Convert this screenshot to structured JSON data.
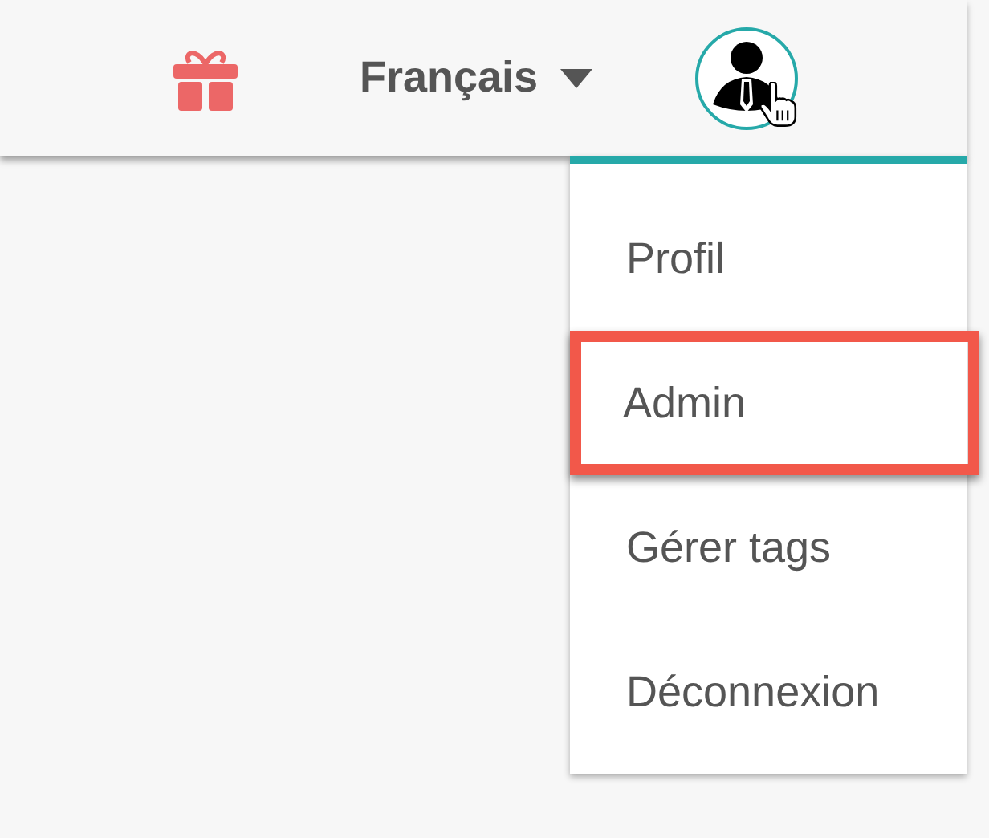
{
  "header": {
    "language": "Français"
  },
  "user_menu": {
    "items": [
      {
        "label": "Profil",
        "highlighted": false
      },
      {
        "label": "Admin",
        "highlighted": true
      },
      {
        "label": "Gérer tags",
        "highlighted": false
      },
      {
        "label": "Déconnexion",
        "highlighted": false
      }
    ]
  }
}
